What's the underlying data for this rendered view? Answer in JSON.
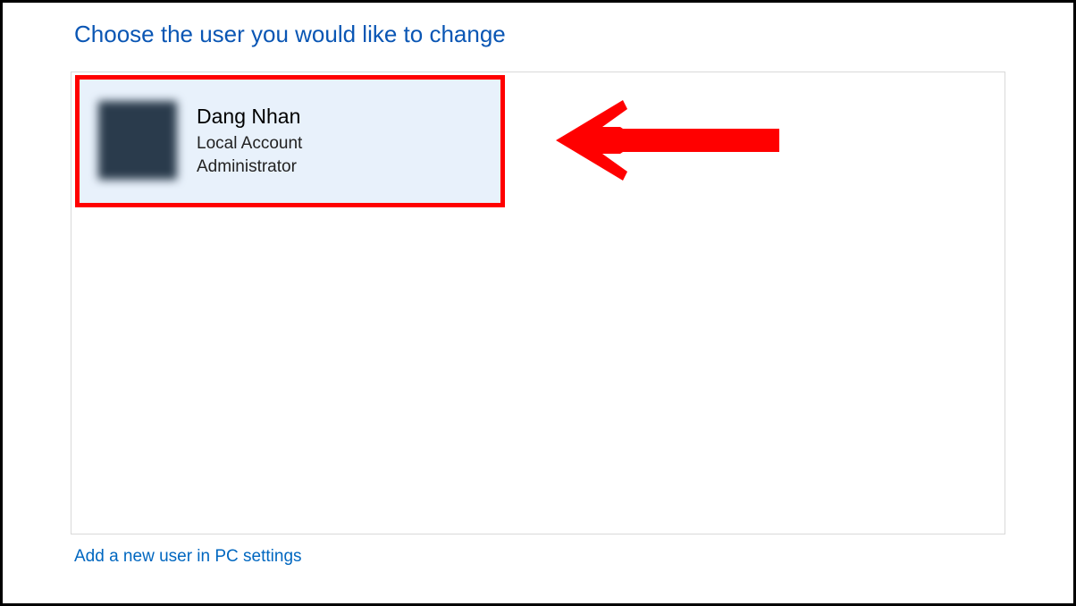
{
  "header": {
    "title": "Choose the user you would like to change"
  },
  "users": [
    {
      "name": "Dang Nhan",
      "account_type": "Local Account",
      "role": "Administrator"
    }
  ],
  "footer": {
    "add_user_link": "Add a new user in PC settings"
  },
  "annotation": {
    "arrow_color": "#ff0000",
    "highlight_color": "#ff0000"
  }
}
